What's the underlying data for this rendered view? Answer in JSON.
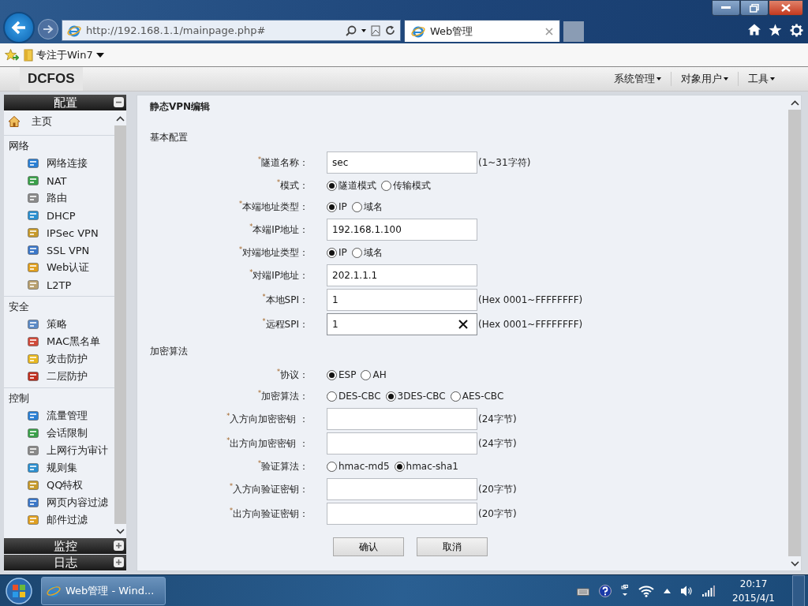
{
  "browser": {
    "address": "http://192.168.1.1/mainpage.php#",
    "tab": {
      "title": "Web管理",
      "selected": true
    },
    "favorites": [
      {
        "label": "专注于Win7"
      }
    ]
  },
  "app": {
    "logo": "DCFOS",
    "menus": [
      "系统管理",
      "对象用户",
      "工具"
    ]
  },
  "sidebar": {
    "panels": [
      {
        "title": "配置",
        "expanded": true,
        "home": "主页",
        "sections": [
          {
            "title": "网络",
            "items": [
              "网络连接",
              "NAT",
              "路由",
              "DHCP",
              "IPSec VPN",
              "SSL VPN",
              "Web认证",
              "L2TP"
            ]
          },
          {
            "title": "安全",
            "items": [
              "策略",
              "MAC黑名单",
              "攻击防护",
              "二层防护"
            ]
          },
          {
            "title": "控制",
            "items": [
              "流量管理",
              "会话限制",
              "上网行为审计",
              "规则集",
              "QQ特权",
              "网页内容过滤",
              "邮件过滤"
            ]
          }
        ]
      },
      {
        "title": "监控",
        "expanded": false
      },
      {
        "title": "日志",
        "expanded": false
      }
    ]
  },
  "form": {
    "title": "静态VPN编辑",
    "sections": [
      {
        "title": "基本配置",
        "rows": [
          {
            "kind": "text",
            "label": "$^{*}$隧道名称：",
            "value": "sec",
            "hint": "(1~31字符)",
            "focused": false
          },
          {
            "kind": "radio",
            "label": "$^{*}$模式：",
            "options": [
              {
                "label": "隧道模式",
                "selected": true
              },
              {
                "label": "传输模式",
                "selected": false
              }
            ]
          },
          {
            "kind": "radio",
            "label": "$^{*}$本端地址类型：",
            "options": [
              {
                "label": "IP",
                "selected": true
              },
              {
                "label": "域名",
                "selected": false
              }
            ]
          },
          {
            "kind": "text",
            "label": "$^{*}$本端IP地址：",
            "value": "192.168.1.100",
            "focused": false
          },
          {
            "kind": "radio",
            "label": "$^{*}$对端地址类型：",
            "options": [
              {
                "label": "IP",
                "selected": true
              },
              {
                "label": "域名",
                "selected": false
              }
            ]
          },
          {
            "kind": "text",
            "label": "$^{*}$对端IP地址：",
            "value": "202.1.1.1",
            "focused": false
          },
          {
            "kind": "text",
            "label": "$^{*}$本地SPI：",
            "value": "1",
            "hint": "(Hex 0001~FFFFFFFF)",
            "focused": false
          },
          {
            "kind": "text",
            "label": "$^{*}$远程SPI：",
            "value": "1",
            "hint": "(Hex 0001~FFFFFFFF)",
            "focused": true
          }
        ]
      },
      {
        "title": "加密算法",
        "rows": [
          {
            "kind": "radio",
            "label": "$^{*}$协议：",
            "options": [
              {
                "label": "ESP",
                "selected": true
              },
              {
                "label": "AH",
                "selected": false
              }
            ]
          },
          {
            "kind": "radio",
            "label": "$^{*}$加密算法：",
            "options": [
              {
                "label": "DES-CBC",
                "selected": false
              },
              {
                "label": "3DES-CBC",
                "selected": true
              },
              {
                "label": "AES-CBC",
                "selected": false
              }
            ]
          },
          {
            "kind": "text",
            "label": "$^{*}$入方向加密密钥 ：",
            "hint": "(24字节)",
            "focused": false
          },
          {
            "kind": "text",
            "label": "$^{*}$出方向加密密钥 ：",
            "hint": "(24字节)",
            "focused": false
          },
          {
            "kind": "radio",
            "label": "$^{*}$验证算法：",
            "options": [
              {
                "label": "hmac-md5",
                "selected": false
              },
              {
                "label": "hmac-sha1",
                "selected": true
              }
            ]
          },
          {
            "kind": "text",
            "label": "$^{*}$入方向验证密钥：",
            "hint": "(20字节)",
            "focused": false
          },
          {
            "kind": "text",
            "label": "$^{*}$出方向验证密钥：",
            "hint": "(20字节)",
            "focused": false
          }
        ]
      }
    ],
    "buttons": [
      "确认",
      "取消"
    ]
  },
  "taskbar": {
    "tasks": [
      {
        "label": "Web管理 - Wind...",
        "selected": true
      }
    ],
    "time": "20:17",
    "date": "2015/4/1"
  }
}
